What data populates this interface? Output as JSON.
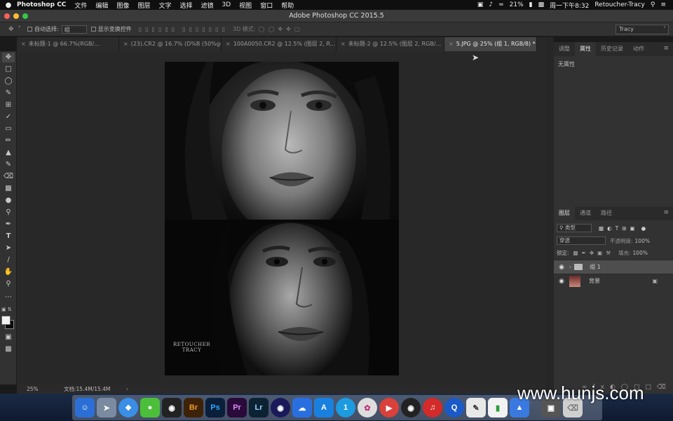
{
  "menubar": {
    "apple": "",
    "app": "Photoshop CC",
    "items": [
      "文件",
      "编辑",
      "图像",
      "图层",
      "文字",
      "选择",
      "滤镜",
      "3D",
      "视图",
      "窗口",
      "帮助"
    ],
    "battery": "21%",
    "clock": "周一下午8:32",
    "user": "Retoucher-Tracy"
  },
  "window": {
    "title": "Adobe Photoshop CC 2015.5"
  },
  "options": {
    "auto_select_label": "自动选择:",
    "auto_select_value": "组",
    "transform_label": "显示变换控件",
    "mode_3d": "3D 模式:",
    "workspace": "Tracy"
  },
  "tabs": [
    {
      "label": "未标题-1 @ 66.7%(RGB/...",
      "active": false
    },
    {
      "label": "(23).CR2 @ 16.7% (D%B  (50%gray), ...",
      "active": false
    },
    {
      "label": "100A0050.CR2 @ 12.5% (图层 2, R...",
      "active": false
    },
    {
      "label": "未标题-2 @ 12.5% (图层 2, RGB/...",
      "active": false
    },
    {
      "label": "5.JPG @ 25% (组 1, RGB/8) *",
      "active": true
    }
  ],
  "document": {
    "signature_line1": "RETOUCHER",
    "signature_line2": "TRACY"
  },
  "status": {
    "zoom": "25%",
    "doc_size": "文档:15.4M/15.4M"
  },
  "properties_panel": {
    "tabs": [
      "调整",
      "属性",
      "历史记录",
      "动作"
    ],
    "active_tab": "属性",
    "empty_text": "无属性"
  },
  "layers_panel": {
    "tabs": [
      "图层",
      "通道",
      "路径"
    ],
    "filter_kind": "类型",
    "blend_mode": "穿透",
    "opacity_label": "不透明度:",
    "opacity_value": "100%",
    "lock_label": "锁定:",
    "fill_label": "填充:",
    "fill_value": "100%",
    "layers": [
      {
        "name": "组 1",
        "type": "group",
        "selected": true
      },
      {
        "name": "背景",
        "type": "image",
        "selected": false,
        "locked": true
      }
    ]
  },
  "dock": {
    "apps": [
      "Finder",
      "Launchpad",
      "Safari",
      "WeChat",
      "QQ",
      "Br",
      "Ps",
      "Pr",
      "Lr",
      "Cinema",
      "Baidu",
      "App",
      "Info",
      "Davinci",
      "Video",
      "OBS",
      "Music",
      "Quicktime",
      "Preview",
      "Numbers",
      "Keynote",
      "Screen",
      "Trash"
    ]
  },
  "watermark": "www.hunjs.com",
  "colors": {
    "accent": "#4e4e4e",
    "traffic_red": "#fc5f57",
    "traffic_yellow": "#fdbb2e",
    "traffic_green": "#34c84a"
  }
}
